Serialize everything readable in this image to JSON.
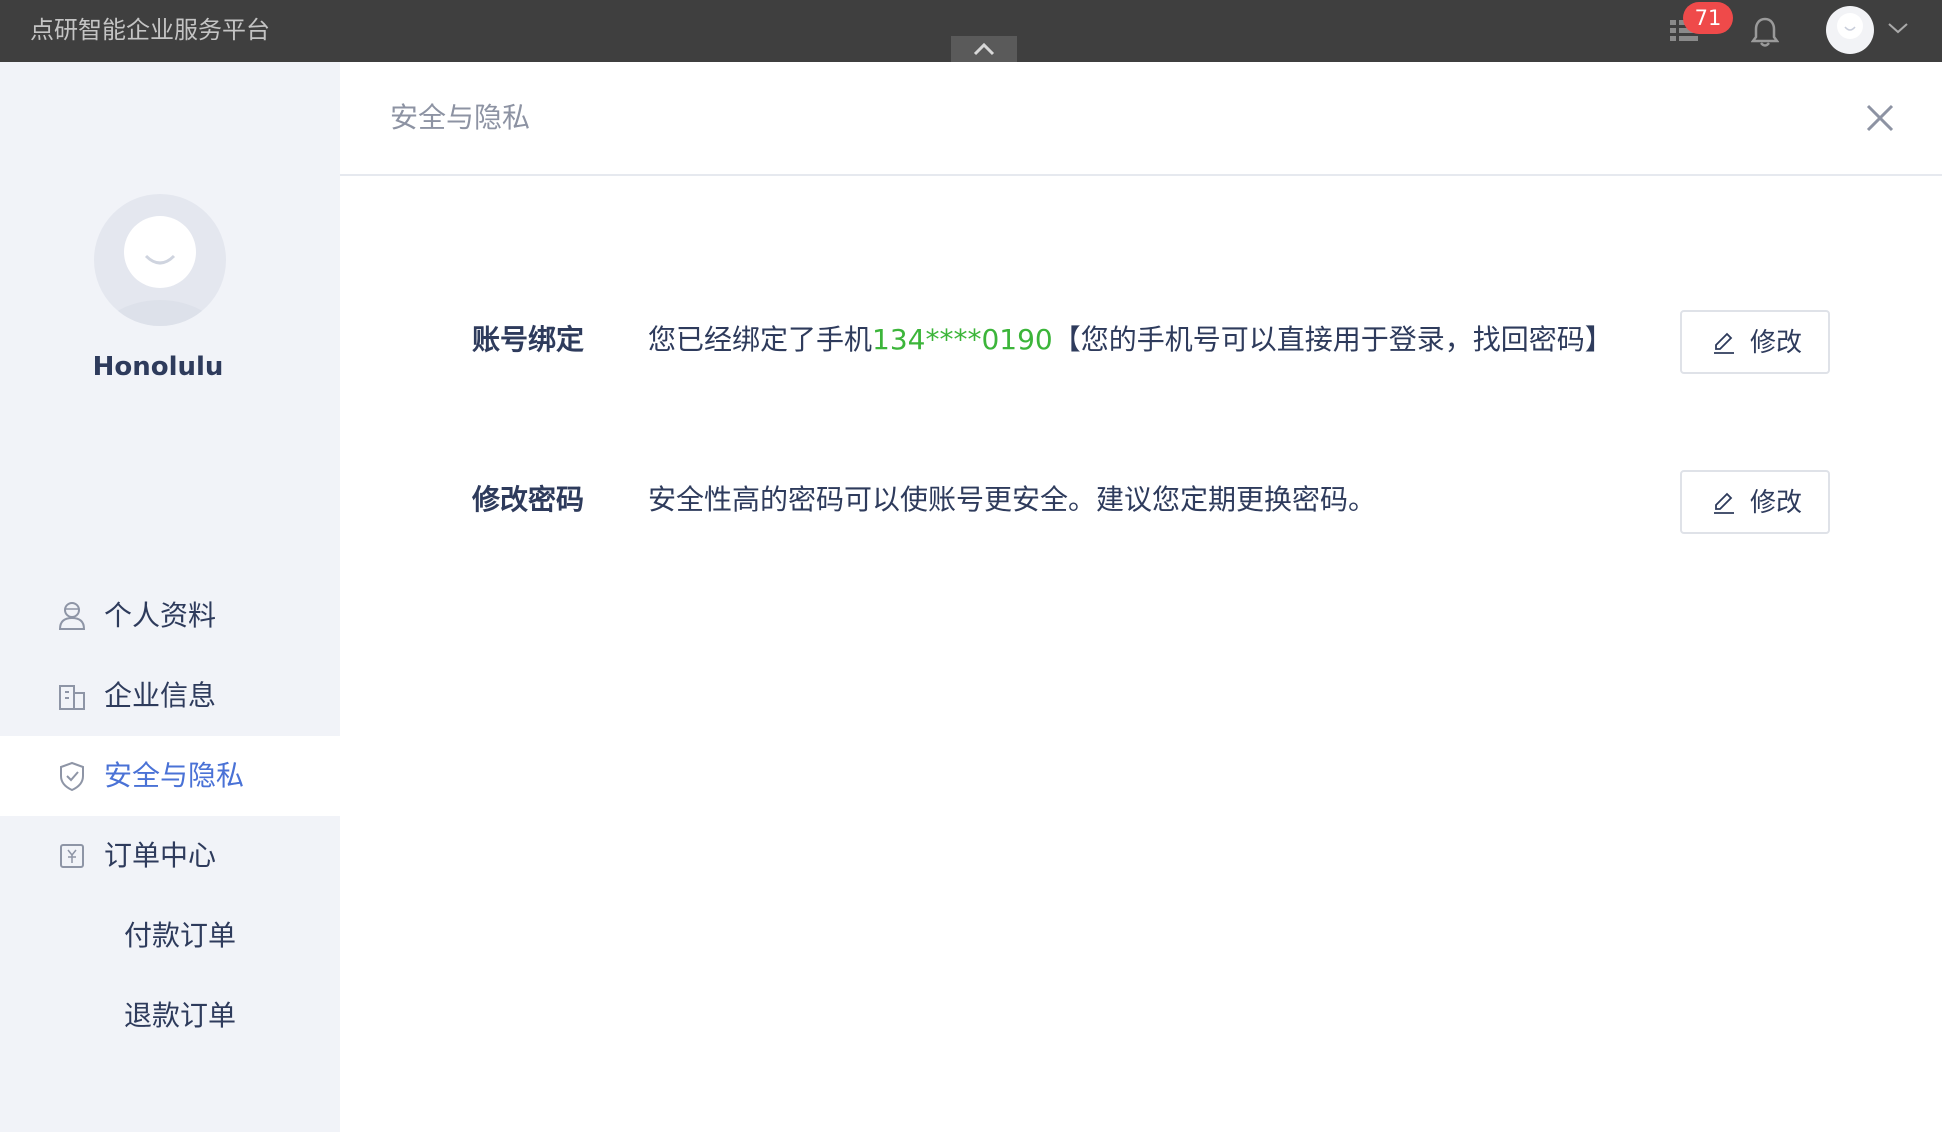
{
  "topbar": {
    "brand": "点研智能企业服务平台",
    "message_count": "71"
  },
  "sidebar": {
    "username": "Honolulu",
    "items": [
      {
        "label": "个人资料",
        "icon": "user-icon"
      },
      {
        "label": "企业信息",
        "icon": "building-icon"
      },
      {
        "label": "安全与隐私",
        "icon": "shield-icon",
        "active": true
      },
      {
        "label": "订单中心",
        "icon": "yuan-icon"
      },
      {
        "label": "付款订单"
      },
      {
        "label": "退款订单"
      }
    ]
  },
  "main": {
    "title": "安全与隐私",
    "rows": [
      {
        "label": "账号绑定",
        "desc_prefix": "您已经绑定了手机",
        "phone": "134****0190",
        "desc_suffix": "【您的手机号可以直接用于登录，找回密码】",
        "button": "修改"
      },
      {
        "label": "修改密码",
        "desc": "安全性高的密码可以使账号更安全。建议您定期更换密码。",
        "button": "修改"
      }
    ]
  },
  "colors": {
    "topbar": "#3f3f3f",
    "sidebar": "#f1f3f8",
    "accent": "#4a72d6",
    "phone": "#3cb53a",
    "badge": "#ef4a4a"
  }
}
